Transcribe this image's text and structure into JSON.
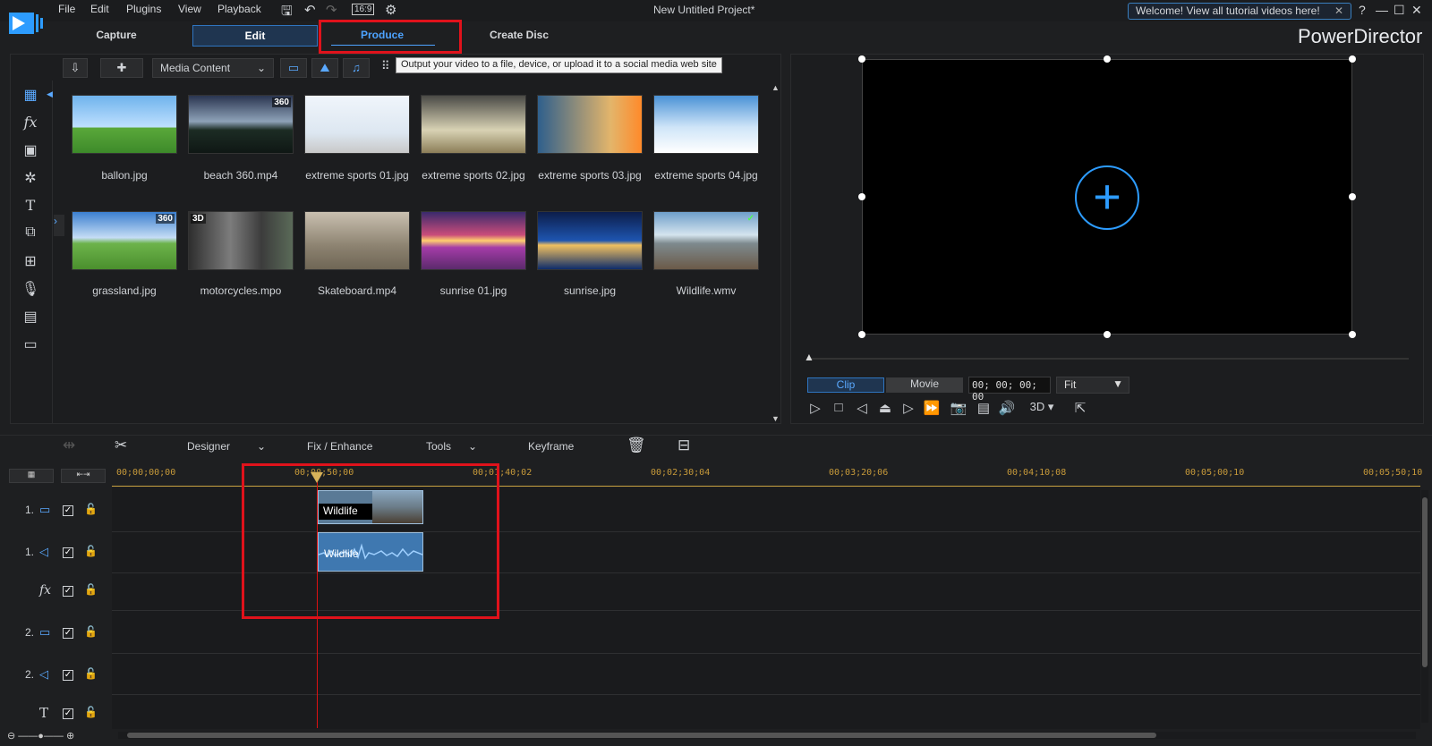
{
  "menubar": {
    "items": [
      "File",
      "Edit",
      "Plugins",
      "View",
      "Playback"
    ],
    "aspect": "16:9",
    "title": "New Untitled Project*",
    "welcome": "Welcome! View all tutorial videos here!",
    "help": "?"
  },
  "modes": {
    "capture": "Capture",
    "edit": "Edit",
    "produce": "Produce",
    "create_disc": "Create Disc"
  },
  "brand": "PowerDirector",
  "library": {
    "content_select": "Media Content",
    "tooltip": "Output your video to a file, device, or upload it to a social media web site",
    "items": [
      {
        "name": "ballon.jpg",
        "badge": ""
      },
      {
        "name": "beach 360.mp4",
        "badge": "360"
      },
      {
        "name": "extreme sports 01.jpg",
        "badge": ""
      },
      {
        "name": "extreme sports 02.jpg",
        "badge": ""
      },
      {
        "name": "extreme sports 03.jpg",
        "badge": ""
      },
      {
        "name": "extreme sports 04.jpg",
        "badge": ""
      },
      {
        "name": "grassland.jpg",
        "badge": "360"
      },
      {
        "name": "motorcycles.mpo",
        "badge": "3D"
      },
      {
        "name": "Skateboard.mp4",
        "badge": ""
      },
      {
        "name": "sunrise 01.jpg",
        "badge": ""
      },
      {
        "name": "sunrise.jpg",
        "badge": ""
      },
      {
        "name": "Wildlife.wmv",
        "badge": "✓"
      }
    ]
  },
  "preview": {
    "clip": "Clip",
    "movie": "Movie",
    "timecode": "00; 00; 00; 00",
    "fit": "Fit",
    "threed": "3D"
  },
  "timeline_toolbar": {
    "designer": "Designer",
    "fix": "Fix / Enhance",
    "tools": "Tools",
    "keyframe": "Keyframe"
  },
  "ruler": [
    "00;00;00;00",
    "00;00;50;00",
    "00;01;40;02",
    "00;02;30;04",
    "00;03;20;06",
    "00;04;10;08",
    "00;05;00;10",
    "00;05;50;10"
  ],
  "tracks": [
    {
      "num": "1.",
      "type": "video"
    },
    {
      "num": "1.",
      "type": "audio"
    },
    {
      "num": "",
      "type": "fx"
    },
    {
      "num": "2.",
      "type": "video"
    },
    {
      "num": "2.",
      "type": "audio"
    },
    {
      "num": "",
      "type": "title"
    }
  ],
  "clips": {
    "video": "Wildlife",
    "audio": "Wildlife"
  },
  "colors": {
    "accent": "#2d9cff",
    "highlight": "#e0121b"
  }
}
